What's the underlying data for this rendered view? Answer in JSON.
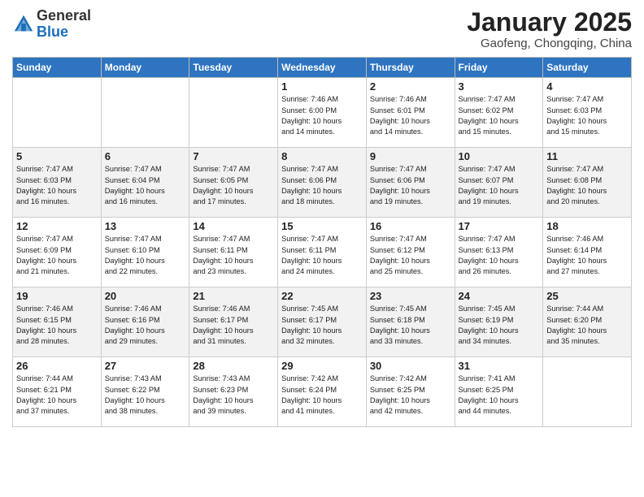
{
  "header": {
    "logo_general": "General",
    "logo_blue": "Blue",
    "title": "January 2025",
    "subtitle": "Gaofeng, Chongqing, China"
  },
  "days_of_week": [
    "Sunday",
    "Monday",
    "Tuesday",
    "Wednesday",
    "Thursday",
    "Friday",
    "Saturday"
  ],
  "weeks": [
    {
      "shaded": false,
      "days": [
        {
          "num": "",
          "info": ""
        },
        {
          "num": "",
          "info": ""
        },
        {
          "num": "",
          "info": ""
        },
        {
          "num": "1",
          "info": "Sunrise: 7:46 AM\nSunset: 6:00 PM\nDaylight: 10 hours\nand 14 minutes."
        },
        {
          "num": "2",
          "info": "Sunrise: 7:46 AM\nSunset: 6:01 PM\nDaylight: 10 hours\nand 14 minutes."
        },
        {
          "num": "3",
          "info": "Sunrise: 7:47 AM\nSunset: 6:02 PM\nDaylight: 10 hours\nand 15 minutes."
        },
        {
          "num": "4",
          "info": "Sunrise: 7:47 AM\nSunset: 6:03 PM\nDaylight: 10 hours\nand 15 minutes."
        }
      ]
    },
    {
      "shaded": true,
      "days": [
        {
          "num": "5",
          "info": "Sunrise: 7:47 AM\nSunset: 6:03 PM\nDaylight: 10 hours\nand 16 minutes."
        },
        {
          "num": "6",
          "info": "Sunrise: 7:47 AM\nSunset: 6:04 PM\nDaylight: 10 hours\nand 16 minutes."
        },
        {
          "num": "7",
          "info": "Sunrise: 7:47 AM\nSunset: 6:05 PM\nDaylight: 10 hours\nand 17 minutes."
        },
        {
          "num": "8",
          "info": "Sunrise: 7:47 AM\nSunset: 6:06 PM\nDaylight: 10 hours\nand 18 minutes."
        },
        {
          "num": "9",
          "info": "Sunrise: 7:47 AM\nSunset: 6:06 PM\nDaylight: 10 hours\nand 19 minutes."
        },
        {
          "num": "10",
          "info": "Sunrise: 7:47 AM\nSunset: 6:07 PM\nDaylight: 10 hours\nand 19 minutes."
        },
        {
          "num": "11",
          "info": "Sunrise: 7:47 AM\nSunset: 6:08 PM\nDaylight: 10 hours\nand 20 minutes."
        }
      ]
    },
    {
      "shaded": false,
      "days": [
        {
          "num": "12",
          "info": "Sunrise: 7:47 AM\nSunset: 6:09 PM\nDaylight: 10 hours\nand 21 minutes."
        },
        {
          "num": "13",
          "info": "Sunrise: 7:47 AM\nSunset: 6:10 PM\nDaylight: 10 hours\nand 22 minutes."
        },
        {
          "num": "14",
          "info": "Sunrise: 7:47 AM\nSunset: 6:11 PM\nDaylight: 10 hours\nand 23 minutes."
        },
        {
          "num": "15",
          "info": "Sunrise: 7:47 AM\nSunset: 6:11 PM\nDaylight: 10 hours\nand 24 minutes."
        },
        {
          "num": "16",
          "info": "Sunrise: 7:47 AM\nSunset: 6:12 PM\nDaylight: 10 hours\nand 25 minutes."
        },
        {
          "num": "17",
          "info": "Sunrise: 7:47 AM\nSunset: 6:13 PM\nDaylight: 10 hours\nand 26 minutes."
        },
        {
          "num": "18",
          "info": "Sunrise: 7:46 AM\nSunset: 6:14 PM\nDaylight: 10 hours\nand 27 minutes."
        }
      ]
    },
    {
      "shaded": true,
      "days": [
        {
          "num": "19",
          "info": "Sunrise: 7:46 AM\nSunset: 6:15 PM\nDaylight: 10 hours\nand 28 minutes."
        },
        {
          "num": "20",
          "info": "Sunrise: 7:46 AM\nSunset: 6:16 PM\nDaylight: 10 hours\nand 29 minutes."
        },
        {
          "num": "21",
          "info": "Sunrise: 7:46 AM\nSunset: 6:17 PM\nDaylight: 10 hours\nand 31 minutes."
        },
        {
          "num": "22",
          "info": "Sunrise: 7:45 AM\nSunset: 6:17 PM\nDaylight: 10 hours\nand 32 minutes."
        },
        {
          "num": "23",
          "info": "Sunrise: 7:45 AM\nSunset: 6:18 PM\nDaylight: 10 hours\nand 33 minutes."
        },
        {
          "num": "24",
          "info": "Sunrise: 7:45 AM\nSunset: 6:19 PM\nDaylight: 10 hours\nand 34 minutes."
        },
        {
          "num": "25",
          "info": "Sunrise: 7:44 AM\nSunset: 6:20 PM\nDaylight: 10 hours\nand 35 minutes."
        }
      ]
    },
    {
      "shaded": false,
      "days": [
        {
          "num": "26",
          "info": "Sunrise: 7:44 AM\nSunset: 6:21 PM\nDaylight: 10 hours\nand 37 minutes."
        },
        {
          "num": "27",
          "info": "Sunrise: 7:43 AM\nSunset: 6:22 PM\nDaylight: 10 hours\nand 38 minutes."
        },
        {
          "num": "28",
          "info": "Sunrise: 7:43 AM\nSunset: 6:23 PM\nDaylight: 10 hours\nand 39 minutes."
        },
        {
          "num": "29",
          "info": "Sunrise: 7:42 AM\nSunset: 6:24 PM\nDaylight: 10 hours\nand 41 minutes."
        },
        {
          "num": "30",
          "info": "Sunrise: 7:42 AM\nSunset: 6:25 PM\nDaylight: 10 hours\nand 42 minutes."
        },
        {
          "num": "31",
          "info": "Sunrise: 7:41 AM\nSunset: 6:25 PM\nDaylight: 10 hours\nand 44 minutes."
        },
        {
          "num": "",
          "info": ""
        }
      ]
    }
  ]
}
